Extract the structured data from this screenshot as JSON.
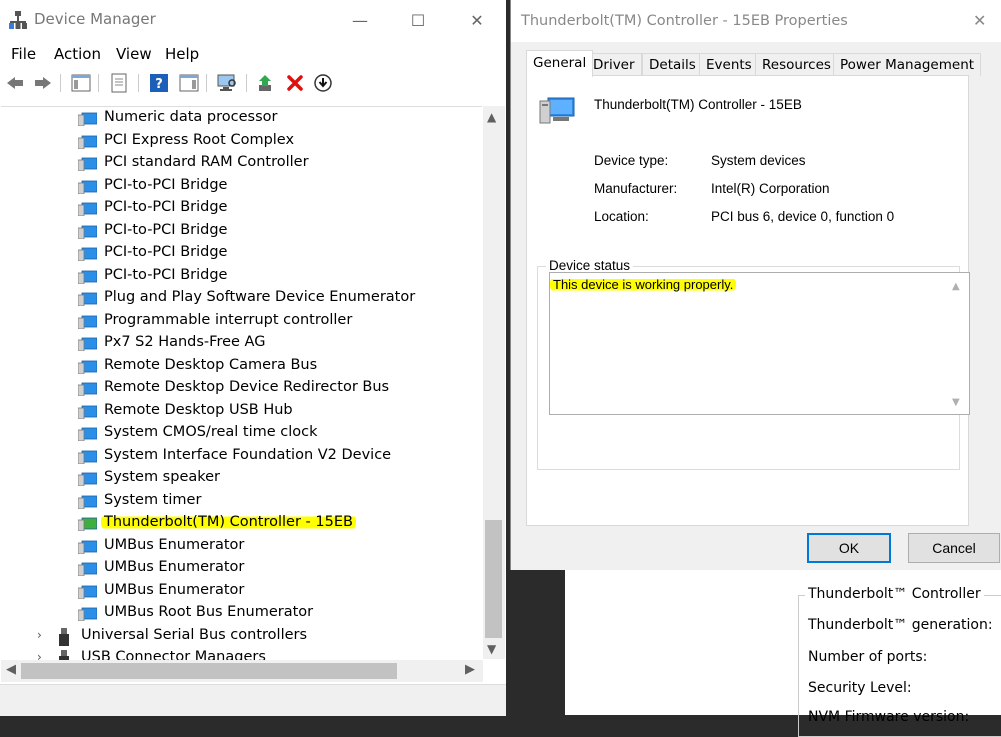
{
  "device_manager": {
    "title": "Device Manager",
    "window_controls": {
      "minimize": "—",
      "maximize": "☐",
      "close": "✕"
    },
    "menu": [
      "File",
      "Action",
      "View",
      "Help"
    ],
    "tree": [
      {
        "label": "Numeric data processor"
      },
      {
        "label": "PCI Express Root Complex"
      },
      {
        "label": "PCI standard RAM Controller"
      },
      {
        "label": "PCI-to-PCI Bridge"
      },
      {
        "label": "PCI-to-PCI Bridge"
      },
      {
        "label": "PCI-to-PCI Bridge"
      },
      {
        "label": "PCI-to-PCI Bridge"
      },
      {
        "label": "PCI-to-PCI Bridge"
      },
      {
        "label": "Plug and Play Software Device Enumerator"
      },
      {
        "label": "Programmable interrupt controller"
      },
      {
        "label": "Px7 S2 Hands-Free AG"
      },
      {
        "label": "Remote Desktop Camera Bus"
      },
      {
        "label": "Remote Desktop Device Redirector Bus"
      },
      {
        "label": "Remote Desktop USB Hub"
      },
      {
        "label": "System CMOS/real time clock"
      },
      {
        "label": "System Interface Foundation V2 Device"
      },
      {
        "label": "System speaker"
      },
      {
        "label": "System timer"
      },
      {
        "label": "Thunderbolt(TM) Controller - 15EB",
        "highlighted": true
      },
      {
        "label": "UMBus Enumerator"
      },
      {
        "label": "UMBus Enumerator"
      },
      {
        "label": "UMBus Enumerator"
      },
      {
        "label": "UMBus Root Bus Enumerator"
      },
      {
        "label": "Universal Serial Bus controllers",
        "category": true
      },
      {
        "label": "USB Connector Managers",
        "category": true
      }
    ]
  },
  "properties": {
    "title": "Thunderbolt(TM) Controller - 15EB Properties",
    "close": "✕",
    "tabs": [
      "General",
      "Driver",
      "Details",
      "Events",
      "Resources",
      "Power Management"
    ],
    "device_name": "Thunderbolt(TM) Controller - 15EB",
    "fields": [
      {
        "label": "Device type:",
        "value": "System devices"
      },
      {
        "label": "Manufacturer:",
        "value": "Intel(R) Corporation"
      },
      {
        "label": "Location:",
        "value": "PCI bus 6, device 0, function 0"
      }
    ],
    "status_title": "Device status",
    "status_text": "This device is working properly.",
    "ok": "OK",
    "cancel": "Cancel"
  },
  "background_window": {
    "group_title": "Thunderbolt™ Controller",
    "fields": [
      "Thunderbolt™ generation:",
      "Number of ports:",
      "Security Level:",
      "NVM Firmware version:"
    ]
  },
  "colors": {
    "highlight": "#ffff00",
    "accent": "#0078d7"
  }
}
